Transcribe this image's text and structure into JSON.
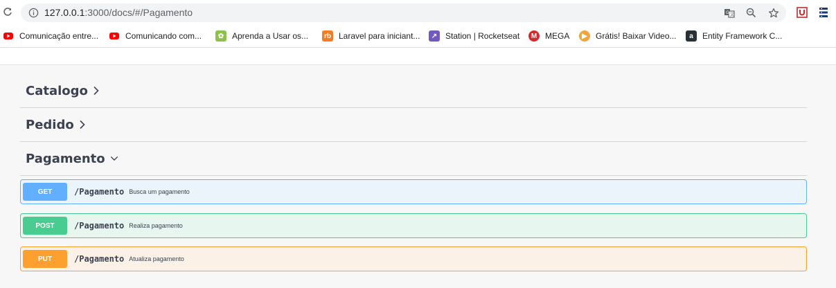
{
  "browser": {
    "url_host": "127.0.0.1",
    "url_rest": ":3000/docs/#/Pagamento",
    "icons": [
      "reload-icon",
      "info-icon",
      "translate-icon",
      "zoom-icon",
      "star-icon",
      "extension-shield-icon",
      "extension-menu-icon"
    ]
  },
  "bookmarks": [
    {
      "label": "Comunicação entre...",
      "icon": "youtube-icon",
      "color": "#ff0000"
    },
    {
      "label": "Comunicando com...",
      "icon": "youtube-icon",
      "color": "#ff0000"
    },
    {
      "label": "Aprenda a Usar os...",
      "icon": "leaf-icon",
      "color": "#8bc34a"
    },
    {
      "label": "Laravel para iniciant...",
      "icon": "rb-icon",
      "color": "#f57c22"
    },
    {
      "label": "Station | Rocketseat",
      "icon": "rocketseat-icon",
      "color": "#7159c1"
    },
    {
      "label": "MEGA",
      "icon": "mega-icon",
      "color": "#d9272e"
    },
    {
      "label": "Grátis! Baixar Video...",
      "icon": "video-download-icon",
      "color": "#f2a33a"
    },
    {
      "label": "Entity Framework C...",
      "icon": "a-icon",
      "color": "#263238"
    }
  ],
  "sections": [
    {
      "title": "Catalogo",
      "expanded": false
    },
    {
      "title": "Pedido",
      "expanded": false
    },
    {
      "title": "Pagamento",
      "expanded": true
    }
  ],
  "operations": [
    {
      "method": "GET",
      "path": "/Pagamento",
      "summary": "Busca um pagamento"
    },
    {
      "method": "POST",
      "path": "/Pagamento",
      "summary": "Realiza pagamento"
    },
    {
      "method": "PUT",
      "path": "/Pagamento",
      "summary": "Atualiza pagamento"
    }
  ]
}
